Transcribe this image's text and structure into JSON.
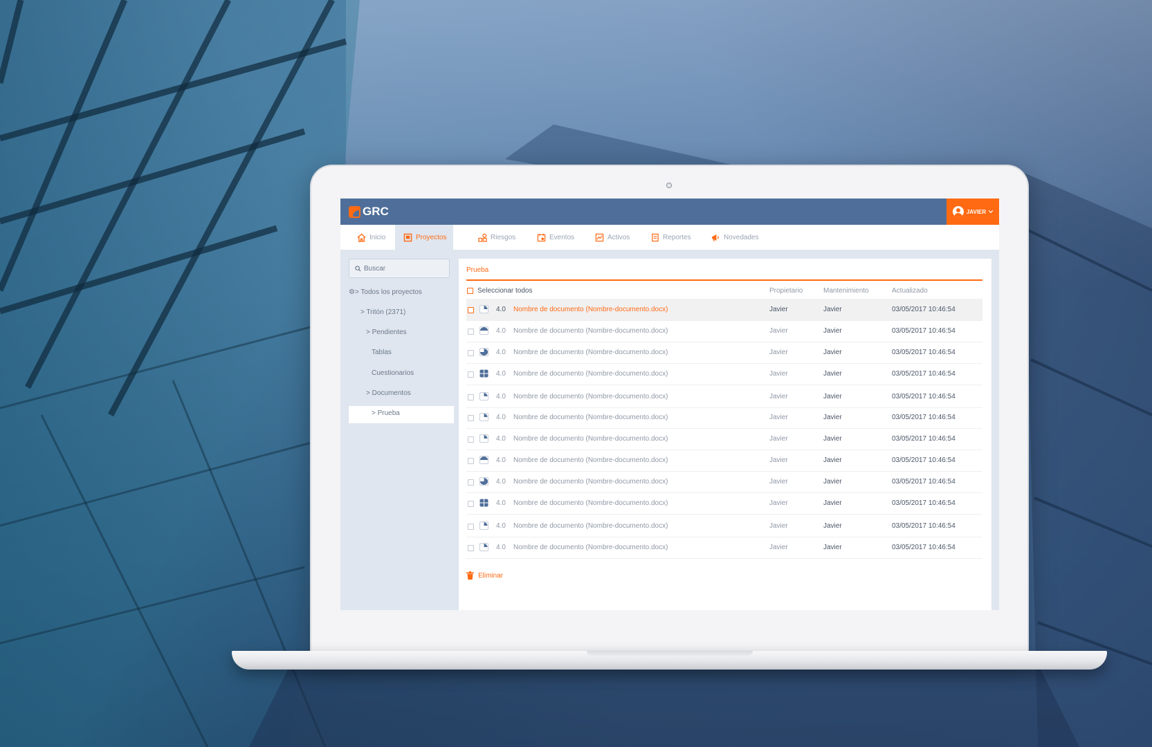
{
  "app": {
    "logo": "GRC",
    "user": "JAVIER"
  },
  "colors": {
    "accent": "#ff6a13",
    "topbar": "#4f6f9a",
    "sidebar": "#dfe6ef"
  },
  "nav": [
    {
      "label": "Inicio",
      "icon": "home-icon"
    },
    {
      "label": "Proyectos",
      "icon": "projects-icon",
      "active": true
    },
    {
      "label": "Riesgos",
      "icon": "risks-icon"
    },
    {
      "label": "Eventos",
      "icon": "events-icon"
    },
    {
      "label": "Activos",
      "icon": "assets-icon"
    },
    {
      "label": "Reportes",
      "icon": "reports-icon"
    },
    {
      "label": "Novedades",
      "icon": "megaphone-icon"
    }
  ],
  "sidebar": {
    "search_placeholder": "Buscar",
    "tree": [
      {
        "label": "> Todos los proyectos"
      },
      {
        "label": "> Tritón (2371)"
      },
      {
        "label": "> Pendientes"
      },
      {
        "label": "Tablas"
      },
      {
        "label": "Cuestionarios"
      },
      {
        "label": "> Documentos"
      },
      {
        "label": "> Prueba",
        "selected": true
      }
    ]
  },
  "panel": {
    "title": "Prueba",
    "select_all": "Seleccionar todos",
    "columns": {
      "owner": "Propietario",
      "maintenance": "Mantenimiento",
      "updated": "Actualizado"
    },
    "rows": [
      {
        "version": "4.0",
        "name": "Nombre de documento (Nombre-documento.docx)",
        "owner": "Javier",
        "maintenance": "Javier",
        "updated": "03/05/2017 10:46:54",
        "icon": "doc-quarter-icon"
      },
      {
        "version": "4.0",
        "name": "Nombre de documento (Nombre-documento.docx)",
        "owner": "Javier",
        "maintenance": "Javier",
        "updated": "03/05/2017 10:46:54",
        "icon": "doc-half-icon"
      },
      {
        "version": "4.0",
        "name": "Nombre de documento (Nombre-documento.docx)",
        "owner": "Javier",
        "maintenance": "Javier",
        "updated": "03/05/2017 10:46:54",
        "icon": "doc-three-quarter-icon"
      },
      {
        "version": "4.0",
        "name": "Nombre de documento (Nombre-documento.docx)",
        "owner": "Javier",
        "maintenance": "Javier",
        "updated": "03/05/2017 10:46:54",
        "icon": "doc-full-icon"
      },
      {
        "version": "4.0",
        "name": "Nombre de documento (Nombre-documento.docx)",
        "owner": "Javier",
        "maintenance": "Javier",
        "updated": "03/05/2017 10:46:54",
        "icon": "doc-quarter-icon"
      },
      {
        "version": "4.0",
        "name": "Nombre de documento (Nombre-documento.docx)",
        "owner": "Javier",
        "maintenance": "Javier",
        "updated": "03/05/2017 10:46:54",
        "icon": "doc-quarter-icon"
      },
      {
        "version": "4.0",
        "name": "Nombre de documento (Nombre-documento.docx)",
        "owner": "Javier",
        "maintenance": "Javier",
        "updated": "03/05/2017 10:46:54",
        "icon": "doc-quarter-icon"
      },
      {
        "version": "4.0",
        "name": "Nombre de documento (Nombre-documento.docx)",
        "owner": "Javier",
        "maintenance": "Javier",
        "updated": "03/05/2017 10:46:54",
        "icon": "doc-half-icon"
      },
      {
        "version": "4.0",
        "name": "Nombre de documento (Nombre-documento.docx)",
        "owner": "Javier",
        "maintenance": "Javier",
        "updated": "03/05/2017 10:46:54",
        "icon": "doc-three-quarter-icon"
      },
      {
        "version": "4.0",
        "name": "Nombre de documento (Nombre-documento.docx)",
        "owner": "Javier",
        "maintenance": "Javier",
        "updated": "03/05/2017 10:46:54",
        "icon": "doc-full-icon"
      },
      {
        "version": "4.0",
        "name": "Nombre de documento (Nombre-documento.docx)",
        "owner": "Javier",
        "maintenance": "Javier",
        "updated": "03/05/2017 10:46:54",
        "icon": "doc-quarter-icon"
      },
      {
        "version": "4.0",
        "name": "Nombre de documento (Nombre-documento.docx)",
        "owner": "Javier",
        "maintenance": "Javier",
        "updated": "03/05/2017 10:46:54",
        "icon": "doc-quarter-icon"
      }
    ],
    "delete_label": "Eliminar"
  }
}
